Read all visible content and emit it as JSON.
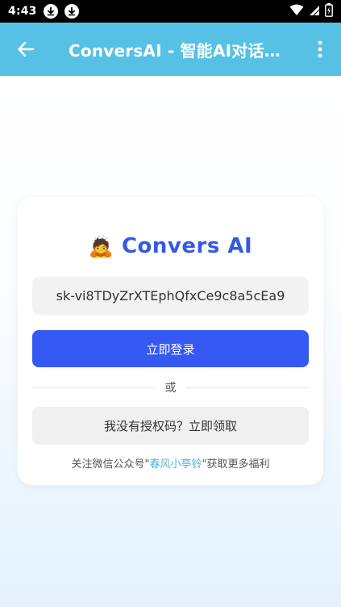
{
  "status_bar": {
    "time": "4:43",
    "icons": [
      "download-icon",
      "download-icon",
      "wifi-icon",
      "signal-icon",
      "battery-charging-icon"
    ]
  },
  "app_bar": {
    "title": "ConversAI - 智能AI对话助手",
    "back_icon": "arrow-left-icon",
    "menu_icon": "more-vertical-icon"
  },
  "login_card": {
    "brand_emoji": "🙇",
    "brand_name": "Convers AI",
    "key_value": "sk-vi8TDyZrXTEphQfxCe9c8a5cEa9",
    "login_label": "立即登录",
    "divider_label": "或",
    "no_code_label": "我没有授权码？立即领取",
    "wechat_prefix": "关注微信公众号\"",
    "wechat_name": "春风小亭铃",
    "wechat_suffix": "\"获取更多福利"
  },
  "colors": {
    "app_bar": "#56c1e4",
    "brand": "#3558e6",
    "primary_button": "#3559f2",
    "link": "#4ab3e0"
  }
}
